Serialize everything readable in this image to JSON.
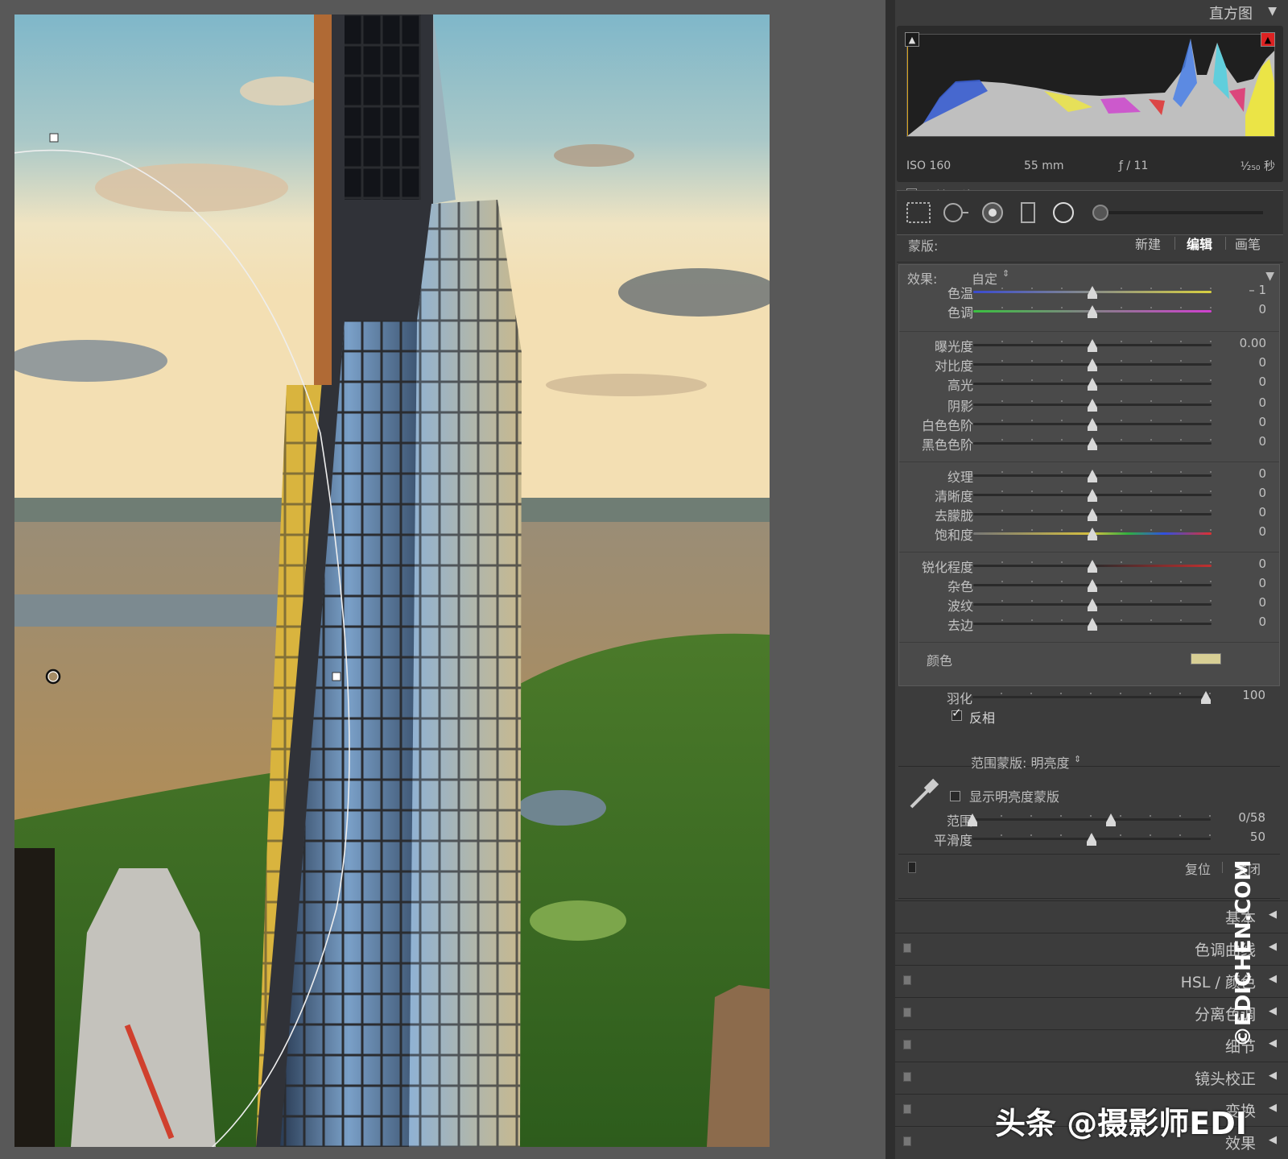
{
  "histogram": {
    "title": "直方图",
    "iso": "ISO 160",
    "focal": "55 mm",
    "aperture": "ƒ / 11",
    "shutter": "¹⁄₂₅₀ 秒",
    "original_label": "原始照片"
  },
  "mask": {
    "label": "蒙版:",
    "new": "新建",
    "edit": "编辑",
    "brush": "画笔"
  },
  "effects": {
    "label": "效果:",
    "preset": "自定",
    "sliders": [
      {
        "key": "temp",
        "label": "色温",
        "value": "– 1",
        "pos": 0.5
      },
      {
        "key": "tint",
        "label": "色调",
        "value": "0",
        "pos": 0.5
      },
      {
        "key": "exposure",
        "label": "曝光度",
        "value": "0.00",
        "pos": 0.5
      },
      {
        "key": "contrast",
        "label": "对比度",
        "value": "0",
        "pos": 0.5
      },
      {
        "key": "highlights",
        "label": "高光",
        "value": "0",
        "pos": 0.5
      },
      {
        "key": "shadows",
        "label": "阴影",
        "value": "0",
        "pos": 0.5
      },
      {
        "key": "whites",
        "label": "白色色阶",
        "value": "0",
        "pos": 0.5
      },
      {
        "key": "blacks",
        "label": "黑色色阶",
        "value": "0",
        "pos": 0.5
      },
      {
        "key": "texture",
        "label": "纹理",
        "value": "0",
        "pos": 0.5
      },
      {
        "key": "clarity",
        "label": "清晰度",
        "value": "0",
        "pos": 0.5
      },
      {
        "key": "dehaze",
        "label": "去朦胧",
        "value": "0",
        "pos": 0.5
      },
      {
        "key": "saturation",
        "label": "饱和度",
        "value": "0",
        "pos": 0.5
      },
      {
        "key": "sharpness",
        "label": "锐化程度",
        "value": "0",
        "pos": 0.5
      },
      {
        "key": "noise",
        "label": "杂色",
        "value": "0",
        "pos": 0.5
      },
      {
        "key": "moire",
        "label": "波纹",
        "value": "0",
        "pos": 0.5
      },
      {
        "key": "defringe",
        "label": "去边",
        "value": "0",
        "pos": 0.5
      }
    ],
    "color_label": "颜色",
    "color_swatch": "#d8cf95"
  },
  "feather": {
    "label": "羽化",
    "value": "100",
    "pos": 0.98,
    "invert_label": "反相",
    "invert_checked": true
  },
  "range_mask": {
    "label": "范围蒙版: 明亮度",
    "show_label": "显示明亮度蒙版",
    "range_label": "范围",
    "range_value": "0/58",
    "range_low": 0.0,
    "range_high": 0.58,
    "smooth_label": "平滑度",
    "smooth_value": "50",
    "smooth_pos": 0.5,
    "reset": "复位",
    "close": "关闭"
  },
  "sections": [
    {
      "label": "基本"
    },
    {
      "label": "色调曲线"
    },
    {
      "label": "HSL / 颜色"
    },
    {
      "label": "分离色调"
    },
    {
      "label": "细节"
    },
    {
      "label": "镜头校正"
    },
    {
      "label": "变换"
    },
    {
      "label": "效果"
    }
  ],
  "watermarks": {
    "vertical": "©EDICHEN.COM",
    "horizontal": "头条 @摄影师EDI"
  }
}
